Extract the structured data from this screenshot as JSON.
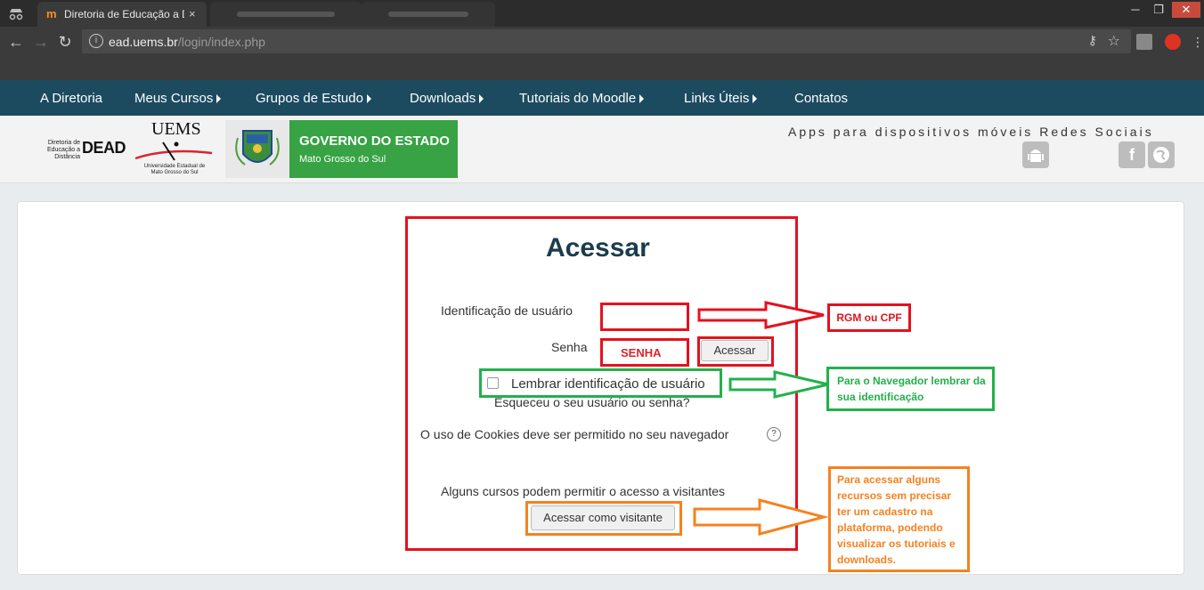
{
  "browser": {
    "tab_title": "Diretoria de Educação a Distância",
    "tab_close": "×",
    "url_host": "ead.uems.br",
    "url_path": "/login/index.php"
  },
  "nav": {
    "items": [
      {
        "label": "A Diretoria",
        "caret": false
      },
      {
        "label": "Meus Cursos",
        "caret": true
      },
      {
        "label": "Grupos de Estudo",
        "caret": true
      },
      {
        "label": "Downloads",
        "caret": true
      },
      {
        "label": "Tutoriais do Moodle",
        "caret": true
      },
      {
        "label": "Links Úteis",
        "caret": true
      },
      {
        "label": "Contatos",
        "caret": false
      }
    ]
  },
  "header": {
    "dead_small": "Diretoria de Educação a Distância",
    "dead_big": "DEAD",
    "uems_top": "UEMS",
    "uems_bottom": "Universidade Estadual de Mato Grosso do Sul",
    "gov_title": "GOVERNO DO ESTADO",
    "gov_sub": "Mato Grosso do Sul",
    "apps_label": "Apps para dispositivos móveis",
    "social_label": "Redes Sociais"
  },
  "login": {
    "title": "Acessar",
    "username_label": "Identificação de usuário",
    "username_value": "",
    "password_label": "Senha",
    "password_value": "SENHA",
    "submit_label": "Acessar",
    "remember_label": "Lembrar identificação de usuário",
    "forgot_label": "Esqueceu o seu usuário ou senha?",
    "cookies_label": "O uso de Cookies deve ser permitido no seu navegador",
    "guest_label": "Alguns cursos podem permitir o acesso a visitantes",
    "guest_button": "Acessar como visitante"
  },
  "annotations": {
    "username_hint": "RGM ou CPF",
    "remember_hint": "Para o Navegador lembrar da sua identificação",
    "guest_hint": "Para acessar alguns recursos sem precisar ter um cadastro na plataforma, podendo visualizar os tutoriais e downloads."
  },
  "colors": {
    "nav_bg": "#1c4b60",
    "annotation_red": "#e3121e",
    "annotation_green": "#22b14c",
    "annotation_orange": "#f58220",
    "gov_green": "#37a344"
  }
}
